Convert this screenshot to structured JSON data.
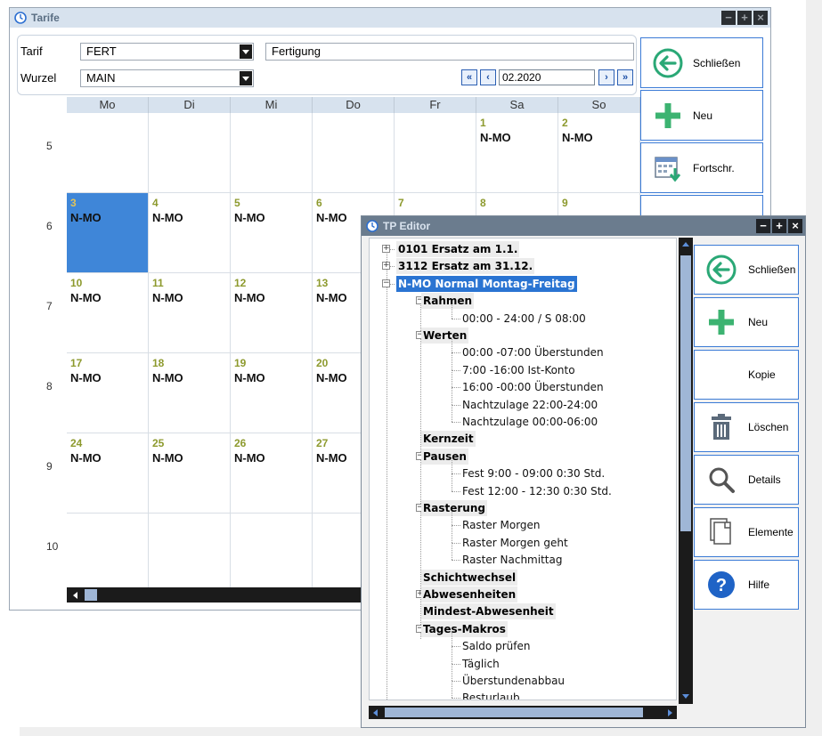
{
  "tarife_window": {
    "title": "Tarife",
    "controls": {
      "minimize": "−",
      "maximize": "+",
      "close": "×"
    },
    "fields": {
      "tarif_label": "Tarif",
      "tarif_value": "FERT",
      "tarif_description": "Fertigung",
      "wurzel_label": "Wurzel",
      "wurzel_value": "MAIN",
      "period": "02.2020"
    },
    "nav": {
      "first": "«",
      "prev": "‹",
      "next": "›",
      "last": "»"
    },
    "calendar": {
      "weekdays": [
        "Mo",
        "Di",
        "Mi",
        "Do",
        "Fr",
        "Sa",
        "So"
      ],
      "weeks": [
        {
          "week": "5",
          "days": [
            {
              "day": "",
              "code": ""
            },
            {
              "day": "",
              "code": ""
            },
            {
              "day": "",
              "code": ""
            },
            {
              "day": "",
              "code": ""
            },
            {
              "day": "",
              "code": ""
            },
            {
              "day": "1",
              "code": "N-MO"
            },
            {
              "day": "2",
              "code": "N-MO"
            }
          ]
        },
        {
          "week": "6",
          "days": [
            {
              "day": "3",
              "code": "N-MO",
              "selected": true
            },
            {
              "day": "4",
              "code": "N-MO"
            },
            {
              "day": "5",
              "code": "N-MO"
            },
            {
              "day": "6",
              "code": "N-MO"
            },
            {
              "day": "7",
              "code": ""
            },
            {
              "day": "8",
              "code": ""
            },
            {
              "day": "9",
              "code": ""
            }
          ]
        },
        {
          "week": "7",
          "days": [
            {
              "day": "10",
              "code": "N-MO"
            },
            {
              "day": "11",
              "code": "N-MO"
            },
            {
              "day": "12",
              "code": "N-MO"
            },
            {
              "day": "13",
              "code": "N-MO"
            },
            {
              "day": "",
              "code": ""
            },
            {
              "day": "",
              "code": ""
            },
            {
              "day": "",
              "code": ""
            }
          ]
        },
        {
          "week": "8",
          "days": [
            {
              "day": "17",
              "code": "N-MO"
            },
            {
              "day": "18",
              "code": "N-MO"
            },
            {
              "day": "19",
              "code": "N-MO"
            },
            {
              "day": "20",
              "code": "N-MO"
            },
            {
              "day": "",
              "code": ""
            },
            {
              "day": "",
              "code": ""
            },
            {
              "day": "",
              "code": ""
            }
          ]
        },
        {
          "week": "9",
          "days": [
            {
              "day": "24",
              "code": "N-MO"
            },
            {
              "day": "25",
              "code": "N-MO"
            },
            {
              "day": "26",
              "code": "N-MO"
            },
            {
              "day": "27",
              "code": "N-MO"
            },
            {
              "day": "",
              "code": ""
            },
            {
              "day": "",
              "code": ""
            },
            {
              "day": "",
              "code": ""
            }
          ]
        },
        {
          "week": "10",
          "days": [
            {
              "day": "",
              "code": ""
            },
            {
              "day": "",
              "code": ""
            },
            {
              "day": "",
              "code": ""
            },
            {
              "day": "",
              "code": ""
            },
            {
              "day": "",
              "code": ""
            },
            {
              "day": "",
              "code": ""
            },
            {
              "day": "",
              "code": ""
            }
          ]
        }
      ]
    },
    "buttons": [
      {
        "label": "Schließen",
        "icon": "back-arrow-icon"
      },
      {
        "label": "Neu",
        "icon": "plus-icon"
      },
      {
        "label": "Fortschr.",
        "icon": "calendar-forward-icon"
      }
    ]
  },
  "tp_editor": {
    "title": "TP Editor",
    "controls": {
      "minimize": "−",
      "maximize": "+",
      "close": "×"
    },
    "tree": [
      {
        "text": "0101 Ersatz am 1.1.",
        "style": "bold",
        "level": 0,
        "expander": "+"
      },
      {
        "text": "3112 Ersatz am 31.12.",
        "style": "bold",
        "level": 0,
        "expander": "+"
      },
      {
        "text": "N-MO Normal Montag-Freitag",
        "style": "selected",
        "level": 0,
        "expander": "−"
      },
      {
        "text": "Rahmen",
        "style": "bold",
        "level": 1,
        "expander": "−"
      },
      {
        "text": "00:00 - 24:00 / S 08:00",
        "style": "leaf",
        "level": 2
      },
      {
        "text": "Werten",
        "style": "bold",
        "level": 1,
        "expander": "−"
      },
      {
        "text": "00:00 -07:00 Überstunden",
        "style": "leaf",
        "level": 2
      },
      {
        "text": "7:00 -16:00 Ist-Konto",
        "style": "leaf",
        "level": 2
      },
      {
        "text": "16:00 -00:00 Überstunden",
        "style": "leaf",
        "level": 2
      },
      {
        "text": "Nachtzulage 22:00-24:00",
        "style": "leaf",
        "level": 2
      },
      {
        "text": "Nachtzulage 00:00-06:00",
        "style": "leaf",
        "level": 2
      },
      {
        "text": "Kernzeit",
        "style": "bold",
        "level": 1
      },
      {
        "text": "Pausen",
        "style": "bold",
        "level": 1,
        "expander": "−"
      },
      {
        "text": "Fest 9:00 - 09:00  0:30 Std.",
        "style": "leaf",
        "level": 2
      },
      {
        "text": "Fest 12:00 - 12:30  0:30 Std.",
        "style": "leaf",
        "level": 2
      },
      {
        "text": "Rasterung",
        "style": "bold",
        "level": 1,
        "expander": "−"
      },
      {
        "text": "Raster Morgen",
        "style": "leaf",
        "level": 2
      },
      {
        "text": "Raster Morgen geht",
        "style": "leaf",
        "level": 2
      },
      {
        "text": "Raster Nachmittag",
        "style": "leaf",
        "level": 2
      },
      {
        "text": "Schichtwechsel",
        "style": "bold",
        "level": 1
      },
      {
        "text": "Abwesenheiten",
        "style": "bold",
        "level": 1,
        "expander": "+"
      },
      {
        "text": "Mindest-Abwesenheit",
        "style": "bold",
        "level": 1
      },
      {
        "text": "Tages-Makros",
        "style": "bold",
        "level": 1,
        "expander": "−"
      },
      {
        "text": "Saldo prüfen",
        "style": "leaf",
        "level": 2
      },
      {
        "text": "Täglich",
        "style": "leaf",
        "level": 2
      },
      {
        "text": "Überstundenabbau",
        "style": "leaf",
        "level": 2
      },
      {
        "text": "Resturlaub",
        "style": "leaf",
        "level": 2
      }
    ],
    "buttons": [
      {
        "label": "Schließen",
        "icon": "back-arrow-icon"
      },
      {
        "label": "Neu",
        "icon": "plus-icon"
      },
      {
        "label": "Kopie",
        "icon": ""
      },
      {
        "label": "Löschen",
        "icon": "trash-icon"
      },
      {
        "label": "Details",
        "icon": "magnifier-icon"
      },
      {
        "label": "Elemente",
        "icon": "documents-icon"
      },
      {
        "label": "Hilfe",
        "icon": "help-icon"
      }
    ]
  },
  "colors": {
    "accent": "#3b7bd6",
    "selection": "#3f86d8",
    "plus_green": "#3cb371",
    "day_number": "#8d9a2e"
  }
}
